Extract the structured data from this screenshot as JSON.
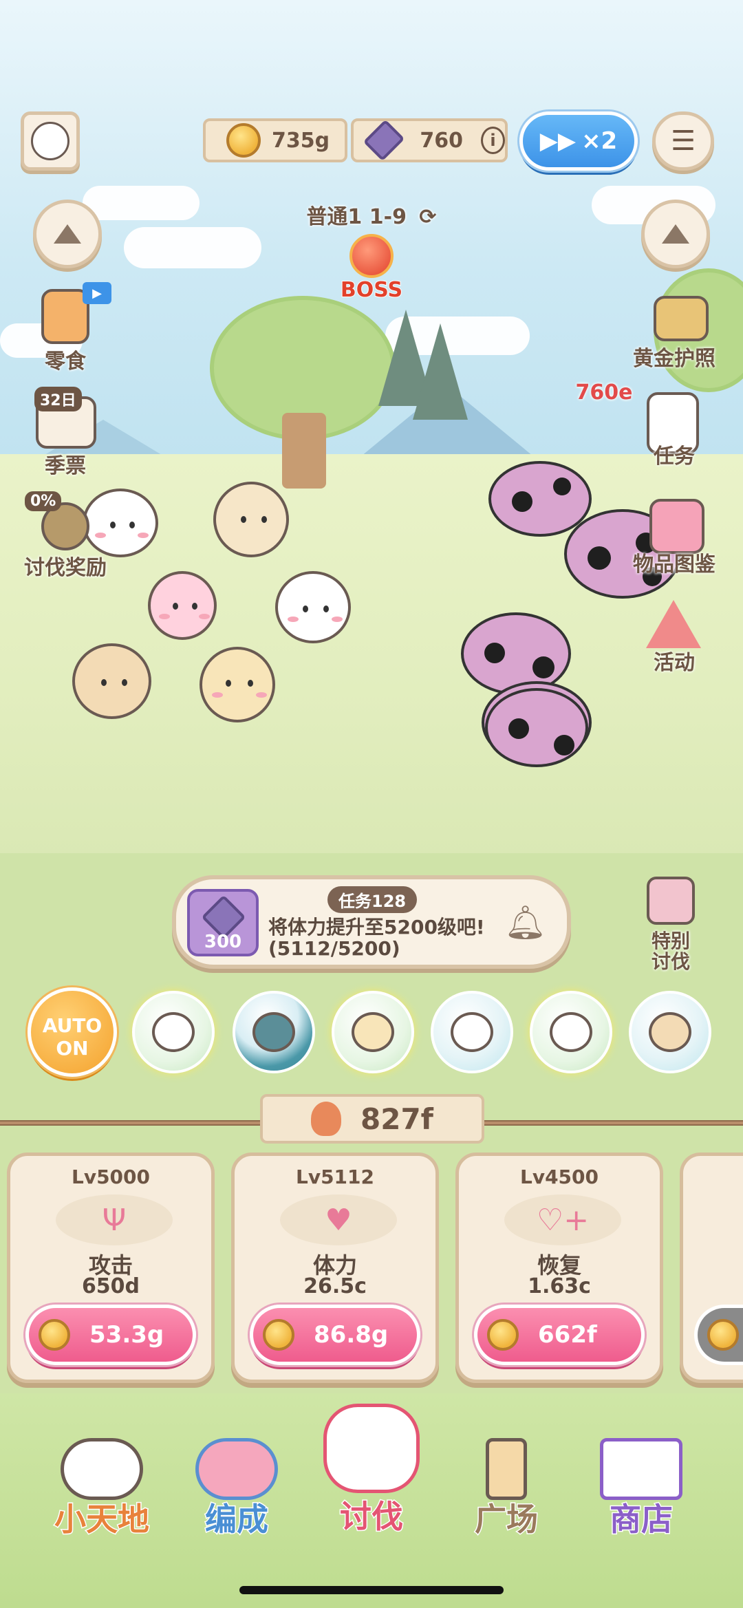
{
  "hud": {
    "coins": "735g",
    "gems": "760",
    "speed": "×2",
    "stage": "普通1 1-9",
    "boss_label": "BOSS"
  },
  "side_left": {
    "snack": "零食",
    "season_badge": "32日",
    "season": "季票",
    "reward_badge": "0%",
    "reward": "讨伐奖励"
  },
  "side_right": {
    "gold_passport": "黄金护照",
    "tasks": "任务",
    "catalog": "物品图鉴",
    "event": "活动"
  },
  "battle": {
    "damage": "760e"
  },
  "quest": {
    "tag": "任务128",
    "reward_count": "300",
    "line1": "将体力提升至5200级吧!",
    "line2": "(5112/5200)"
  },
  "special": {
    "label_1": "特别",
    "label_2": "讨伐"
  },
  "auto": {
    "line1": "AUTO",
    "line2": "ON"
  },
  "dps": "827f",
  "stats": [
    {
      "level": "Lv5000",
      "name": "攻击",
      "value": "650d",
      "cost": "53.3g"
    },
    {
      "level": "Lv5112",
      "name": "体力",
      "value": "26.5c",
      "cost": "86.8g"
    },
    {
      "level": "Lv4500",
      "name": "恢复",
      "value": "1.63c",
      "cost": "662f"
    }
  ],
  "nav": {
    "home": "小天地",
    "team": "编成",
    "battle": "讨伐",
    "square": "广场",
    "shop": "商店"
  },
  "colors": {
    "accent_pink": "#ef5c8d",
    "speed_blue": "#3d93e8",
    "nav_orange": "#e8823b",
    "nav_blue": "#4a8fd4",
    "nav_red": "#e45573",
    "nav_brown": "#9a7a5c",
    "nav_purple": "#8b5fc8"
  }
}
